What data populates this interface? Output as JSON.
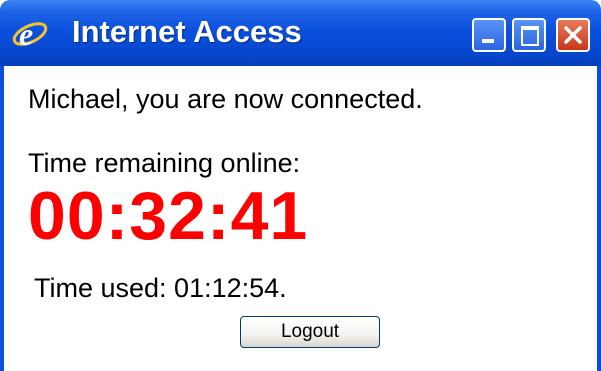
{
  "window": {
    "title": "Internet Access",
    "icon": "internet-explorer-icon",
    "controls": [
      "minimize-icon",
      "maximize-icon",
      "close-icon"
    ]
  },
  "content": {
    "connected_message": "Michael, you are now connected.",
    "remaining_label": "Time remaining online:",
    "remaining_time": "00:32:41",
    "used_text": "Time used: 01:12:54."
  },
  "buttons": {
    "logout_label": "Logout"
  },
  "colors": {
    "titlebar": "#0a4fdc",
    "countdown": "#ff0000",
    "close_button": "#c8361a"
  }
}
